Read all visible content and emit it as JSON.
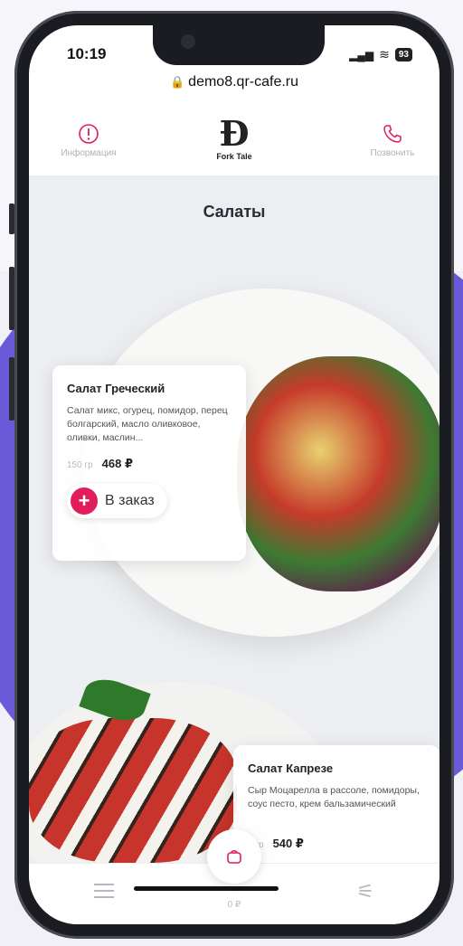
{
  "status": {
    "time": "10:19",
    "battery": "93"
  },
  "browser": {
    "url": "demo8.qr-cafe.ru"
  },
  "header": {
    "info_label": "Информация",
    "logo_text": "Fork Tale",
    "call_label": "Позвонить"
  },
  "section": {
    "title": "Салаты"
  },
  "dishes": [
    {
      "name": "Салат Греческий",
      "description": "Салат микс, огурец, помидор, перец болгарский, масло оливковое, оливки, маслин...",
      "weight": "150 гр",
      "price": "468 ₽",
      "order_label": "В заказ"
    },
    {
      "name": "Салат Капрезе",
      "description": "Сыр Моцарелла в рассоле, помидоры, соус песто, крем бальзамический",
      "weight": "0 гр",
      "price": "540 ₽"
    }
  ],
  "cart": {
    "total": "0 ₽"
  },
  "colors": {
    "accent": "#e11d5c",
    "background_accent": "#6b5ad8"
  }
}
